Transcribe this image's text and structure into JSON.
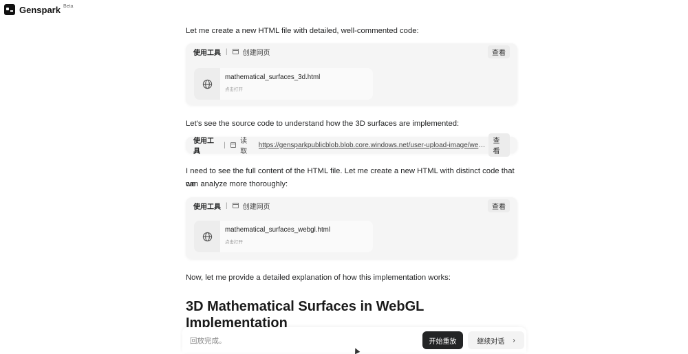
{
  "brand": {
    "name": "Genspark",
    "badge": "Beta"
  },
  "messages": [
    "Let me create a new HTML file with detailed, well-commented code:",
    "Let's see the source code to understand how the 3D surfaces are implemented:",
    "I need to see the full content of the HTML file. Let me create a new HTML with distinct code that we",
    "can analyze more thoroughly:",
    "Now, let me provide a detailed explanation of how this implementation works:"
  ],
  "tools": [
    {
      "label": "使用工具",
      "action": "创建网页",
      "view": "查看",
      "file": {
        "name": "mathematical_surfaces_3d.html",
        "hint": "点击打开"
      }
    },
    {
      "label": "使用工具",
      "action": "读取",
      "link": "https://gensparkpublicblob.blob.core.windows.net/user-upload-image/webpage_...",
      "view": "查看"
    },
    {
      "label": "使用工具",
      "action": "创建网页",
      "view": "查看",
      "file": {
        "name": "mathematical_surfaces_webgl.html",
        "hint": "点击打开"
      }
    }
  ],
  "heading": {
    "line1": "3D Mathematical Surfaces in WebGL",
    "line2": "Implementation"
  },
  "bottom": {
    "status": "回放完成。",
    "replay_label": "开始重放",
    "continue_label": "继续对话",
    "continue_icon": "chevron-right-icon"
  }
}
